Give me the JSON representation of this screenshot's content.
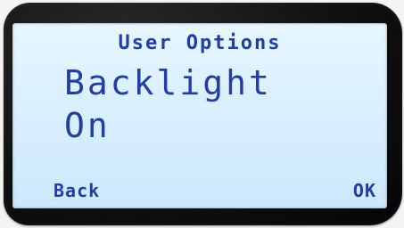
{
  "display": {
    "title": "User Options",
    "setting_label": "Backlight",
    "setting_value": "On"
  },
  "softkeys": {
    "left": "Back",
    "right": "OK"
  },
  "colors": {
    "lcd_text": "#1f3fa6",
    "lcd_background": "#d8efff",
    "bezel": "#111111"
  }
}
